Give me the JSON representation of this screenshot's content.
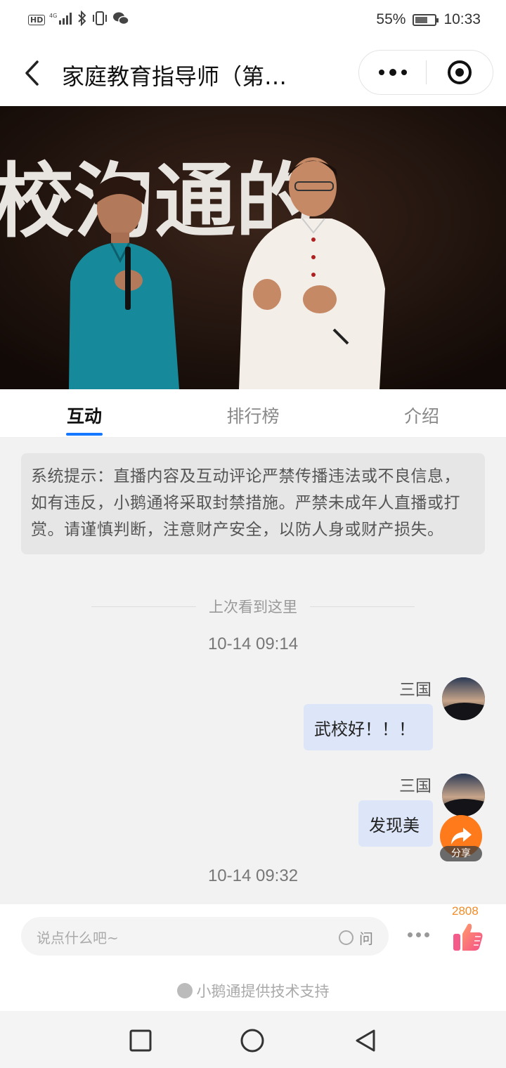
{
  "status_bar": {
    "network": "HD 4G",
    "battery_percent": "55%",
    "battery_level": 0.55,
    "time": "10:33"
  },
  "header": {
    "title": "家庭教育指导师（第…",
    "more_icon": "more-dots-icon",
    "close_icon": "target-close-icon"
  },
  "video": {
    "banner_text": "校沟通的"
  },
  "tabs": [
    {
      "label": "互动",
      "active": true
    },
    {
      "label": "排行榜",
      "active": false
    },
    {
      "label": "介绍",
      "active": false
    }
  ],
  "chat": {
    "system_notice": "系统提示：直播内容及互动评论严禁传播违法或不良信息，如有违反，小鹅通将采取封禁措施。严禁未成年人直播或打赏。请谨慎判断，注意财产安全，以防人身或财产损失。",
    "last_seen": "上次看到这里",
    "timestamps": [
      "10-14 09:14",
      "10-14 09:32"
    ],
    "messages": [
      {
        "author": "三国",
        "text": "武校好！！！"
      },
      {
        "author": "三国",
        "text": "发现美"
      }
    ],
    "share_label": "分享"
  },
  "input_bar": {
    "placeholder": "说点什么吧~",
    "ask_label": "问",
    "like_count": "2808",
    "powered_by": "小鹅通提供技术支持"
  },
  "colors": {
    "accent": "#1677ff",
    "bubble": "#dde6f8",
    "share": "#ff7a1a",
    "like": "#f28c28"
  }
}
